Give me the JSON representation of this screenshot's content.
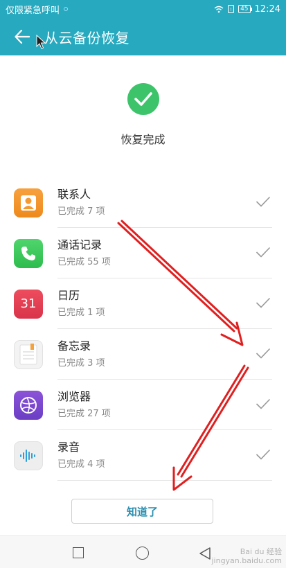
{
  "status_bar": {
    "carrier": "仅限紧急呼叫",
    "battery": "45",
    "time": "12:24"
  },
  "header": {
    "title": "从云备份恢复",
    "back_icon": "arrow-left-icon"
  },
  "result": {
    "icon": "check-circle-icon",
    "text": "恢复完成"
  },
  "items": [
    {
      "name": "联系人",
      "status": "已完成 7 项",
      "icon": "contacts-icon"
    },
    {
      "name": "通话记录",
      "status": "已完成 55 项",
      "icon": "phone-icon"
    },
    {
      "name": "日历",
      "status": "已完成 1 项",
      "icon": "calendar-icon",
      "icon_text": "31"
    },
    {
      "name": "备忘录",
      "status": "已完成 3 项",
      "icon": "memo-icon"
    },
    {
      "name": "浏览器",
      "status": "已完成 27 项",
      "icon": "browser-icon"
    },
    {
      "name": "录音",
      "status": "已完成 4 项",
      "icon": "recorder-icon"
    }
  ],
  "button": {
    "label": "知道了"
  },
  "watermark": {
    "line1": "Bai du 经验",
    "line2": "jingyan.baidu.com"
  },
  "colors": {
    "accent": "#27a9bf",
    "success": "#3dc36a",
    "annotation_arrow": "#e02020"
  }
}
